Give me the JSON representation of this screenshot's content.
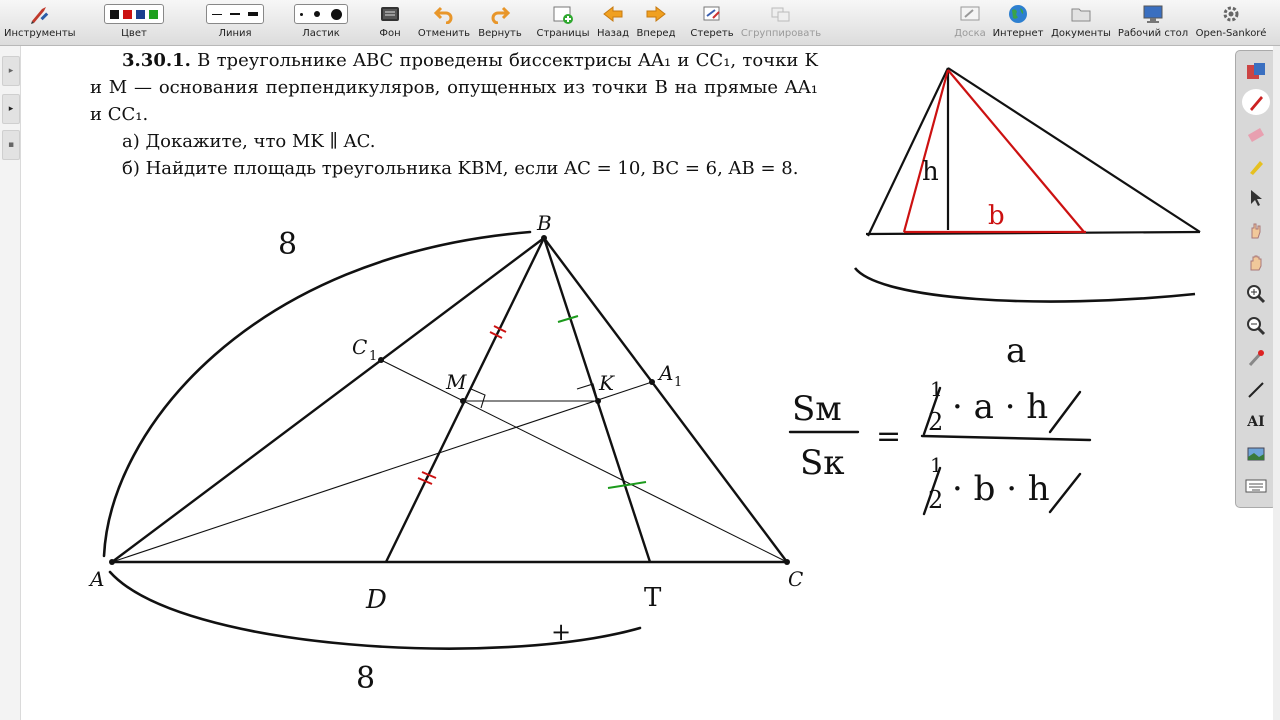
{
  "toolbar": {
    "tools": "Инструменты",
    "color": "Цвет",
    "line": "Линия",
    "eraser": "Ластик",
    "background": "Фон",
    "undo": "Отменить",
    "redo": "Вернуть",
    "pages": "Страницы",
    "back": "Назад",
    "forward": "Вперед",
    "erase": "Стереть",
    "group": "Сгруппировать",
    "board": "Доска",
    "internet": "Интернет",
    "documents": "Документы",
    "desktop": "Рабочий стол",
    "app": "Open-Sankoré"
  },
  "colors": {
    "black": "#111111",
    "red": "#cc1111",
    "blue": "#1a3f8f",
    "green": "#1fa01f",
    "ink_red": "#cc1111",
    "ink_green": "#1c9a1c"
  },
  "problem": {
    "number": "3.30.1.",
    "line1": " В треугольнике ABC проведены биссектрисы AA₁ и CC₁, точки K и M — основания перпендикуляров, опущенных из точки B на прямые AA₁ и CC₁.",
    "part_a": "а) Докажите, что MK ∥ AC.",
    "part_b": "б) Найдите площадь треугольника KBM, если AC = 10, BC = 6, AB = 8."
  },
  "figure": {
    "labels": {
      "A": "A",
      "B": "B",
      "C": "C",
      "C1": "C",
      "C1_sub": "1",
      "A1": "A",
      "A1_sub": "1",
      "M": "M",
      "K": "K"
    },
    "handwriting": {
      "ab_len": "8",
      "bottom_len": "8",
      "D": "D",
      "T": "T",
      "plus": "+"
    }
  },
  "sketch": {
    "h": "h",
    "b": "b",
    "a": "a"
  },
  "formula": {
    "lhs_num": "Sм",
    "lhs_den": "Sк",
    "eq": "=",
    "half_num": "1",
    "half_den": "2",
    "rhs_num_rest": "· a · h",
    "rhs_den_rest": "· b · h"
  }
}
